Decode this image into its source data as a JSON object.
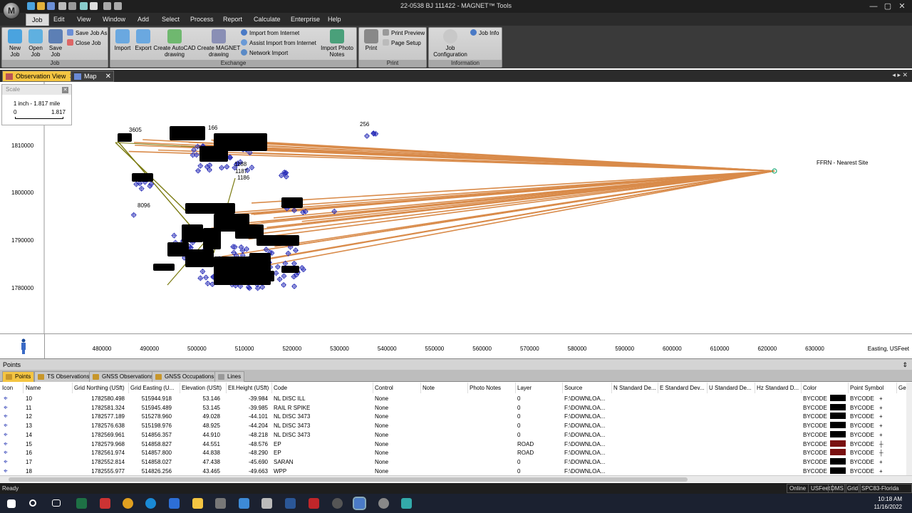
{
  "window": {
    "title": "22-0538 BJ 111422 - MAGNET™ Tools",
    "app_orb": "M",
    "minimize": "—",
    "maximize": "▢",
    "close": "✕"
  },
  "menu": [
    "Job",
    "Edit",
    "View",
    "Window",
    "Add",
    "Select",
    "Process",
    "Report",
    "Calculate",
    "Enterprise",
    "Help"
  ],
  "ribbon": {
    "groups": {
      "job": "Job",
      "exchange": "Exchange",
      "print": "Print",
      "information": "Information"
    },
    "new_job": "New\nJob",
    "open_job": "Open\nJob",
    "save_job": "Save\nJob",
    "save_job_as": "Save Job As",
    "close_job": "Close Job",
    "import": "Import",
    "export": "Export",
    "create_autocad": "Create AutoCAD\ndrawing",
    "create_magnet": "Create MAGNET\ndrawing",
    "import_internet": "Import from Internet",
    "assist_import": "Assist Import from Internet",
    "network_import": "Network Import",
    "import_photo": "Import Photo\nNotes",
    "print": "Print",
    "print_preview": "Print Preview",
    "page_setup": "Page Setup",
    "job_config": "Job\nConfiguration",
    "job_info": "Job Info"
  },
  "doc_tabs": {
    "observation": "Observation View",
    "map": "Map View"
  },
  "scale": {
    "header": "Scale",
    "text": "1 inch - 1.817 mile",
    "min": "0",
    "max": "1.817"
  },
  "graph": {
    "y_ticks": [
      "1810000",
      "1800000",
      "1790000",
      "1780000"
    ],
    "x_ticks": [
      "480000",
      "490000",
      "500000",
      "510000",
      "520000",
      "530000",
      "540000",
      "550000",
      "560000",
      "570000",
      "580000",
      "590000",
      "600000",
      "610000",
      "620000",
      "630000"
    ],
    "x_unit": "Easting, USFeet",
    "labels": {
      "remote_site": "FFRN - Nearest Site",
      "l8096": "8096",
      "l256": "256",
      "l3605": "3605",
      "l166": "166",
      "l1188": "1188",
      "l1187": "1187",
      "l1186": "1186"
    },
    "colors": {
      "vector": "#d98b4a",
      "vector_olive": "#7a7a10",
      "point": "#2a2fb8",
      "label": "#000000"
    }
  },
  "points_panel": {
    "title": "Points",
    "tabs": [
      "Points",
      "TS Observations",
      "GNSS Observations",
      "GNSS Occupations",
      "Lines"
    ],
    "columns": [
      "Icon",
      "Name",
      "Grid Northing (USft)",
      "Grid Easting (U...",
      "Elevation (USft)",
      "Ell.Height (USft)",
      "Code",
      "Control",
      "Note",
      "Photo Notes",
      "Layer",
      "Source",
      "N Standard De...",
      "E Standard Dev...",
      "U Standard De...",
      "Hz Standard D...",
      "Color",
      "Point Symbol",
      "Ge"
    ],
    "rows": [
      {
        "name": "10",
        "northing": "1782580.498",
        "easting": "515944.918",
        "elev": "53.146",
        "ell": "-39.984",
        "code": "NL DISC ILL",
        "control": "None",
        "layer": "0",
        "source": "F:\\DOWNLOA...",
        "color": "BYCODE",
        "swatch": "#000000",
        "symbol": "BYCODE",
        "glyph": "+"
      },
      {
        "name": "11",
        "northing": "1782581.324",
        "easting": "515945.489",
        "elev": "53.145",
        "ell": "-39.985",
        "code": "RAIL R SPIKE",
        "control": "None",
        "layer": "0",
        "source": "F:\\DOWNLOA...",
        "color": "BYCODE",
        "swatch": "#000000",
        "symbol": "BYCODE",
        "glyph": "+"
      },
      {
        "name": "12",
        "northing": "1782577.189",
        "easting": "515278.960",
        "elev": "49.028",
        "ell": "-44.101",
        "code": "NL DISC 3473",
        "control": "None",
        "layer": "0",
        "source": "F:\\DOWNLOA...",
        "color": "BYCODE",
        "swatch": "#000000",
        "symbol": "BYCODE",
        "glyph": "+"
      },
      {
        "name": "13",
        "northing": "1782576.638",
        "easting": "515198.976",
        "elev": "48.925",
        "ell": "-44.204",
        "code": "NL DISC 3473",
        "control": "None",
        "layer": "0",
        "source": "F:\\DOWNLOA...",
        "color": "BYCODE",
        "swatch": "#000000",
        "symbol": "BYCODE",
        "glyph": "+"
      },
      {
        "name": "14",
        "northing": "1782569.961",
        "easting": "514856.357",
        "elev": "44.910",
        "ell": "-48.218",
        "code": "NL DISC 3473",
        "control": "None",
        "layer": "0",
        "source": "F:\\DOWNLOA...",
        "color": "BYCODE",
        "swatch": "#000000",
        "symbol": "BYCODE",
        "glyph": "+"
      },
      {
        "name": "15",
        "northing": "1782579.968",
        "easting": "514858.827",
        "elev": "44.551",
        "ell": "-48.576",
        "code": "EP",
        "control": "None",
        "layer": "ROAD",
        "source": "F:\\DOWNLOA...",
        "color": "BYCODE",
        "swatch": "#7a1010",
        "symbol": "BYCODE",
        "glyph": "┼"
      },
      {
        "name": "16",
        "northing": "1782561.974",
        "easting": "514857.800",
        "elev": "44.838",
        "ell": "-48.290",
        "code": "EP",
        "control": "None",
        "layer": "ROAD",
        "source": "F:\\DOWNLOA...",
        "color": "BYCODE",
        "swatch": "#7a1010",
        "symbol": "BYCODE",
        "glyph": "┼"
      },
      {
        "name": "17",
        "northing": "1782552.814",
        "easting": "514858.027",
        "elev": "47.438",
        "ell": "-45.690",
        "code": "SARAN",
        "control": "None",
        "layer": "0",
        "source": "F:\\DOWNLOA...",
        "color": "BYCODE",
        "swatch": "#000000",
        "symbol": "BYCODE",
        "glyph": "+"
      },
      {
        "name": "18",
        "northing": "1782555.977",
        "easting": "514826.256",
        "elev": "43.465",
        "ell": "-49.663",
        "code": "WPP",
        "control": "None",
        "layer": "0",
        "source": "F:\\DOWNLOA...",
        "color": "BYCODE",
        "swatch": "#000000",
        "symbol": "BYCODE",
        "glyph": "+"
      }
    ]
  },
  "status": {
    "ready": "Ready",
    "items": [
      "Online",
      "USFeet",
      "DMS",
      "Grid",
      "SPC83-Florida (East)"
    ]
  },
  "taskbar": {
    "time": "10:18 AM",
    "date": "11/16/2022"
  }
}
